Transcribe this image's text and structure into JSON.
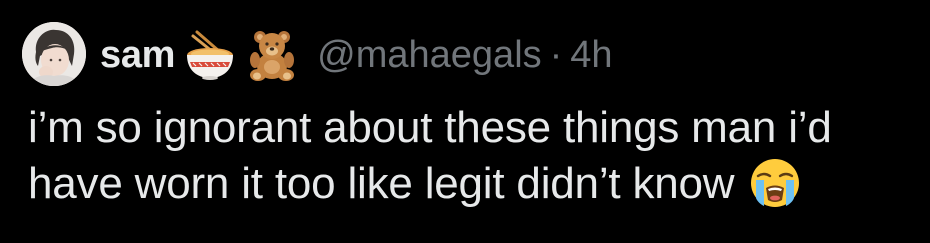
{
  "tweet": {
    "display_name": "sam",
    "name_emojis": [
      "ramen-bowl-icon",
      "teddy-bear-icon"
    ],
    "handle": "@mahaegals",
    "separator": "·",
    "time": "4h",
    "text_line1": "i’m so ignorant about these things man i’d",
    "text_line2": "have worn it too like legit didn’t know",
    "trailing_emoji": "loudly-crying-face-icon"
  },
  "colors": {
    "background": "#000000",
    "primary_text": "#e7e9ea",
    "secondary_text": "#71767b"
  }
}
